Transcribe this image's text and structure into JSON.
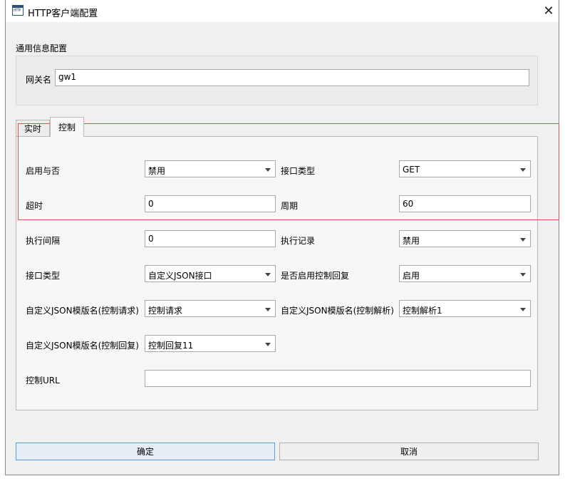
{
  "window": {
    "title": "HTTP客户端配置",
    "app_icon_text": "HTTP"
  },
  "general": {
    "section_label": "通用信息配置",
    "gateway_label": "网关名",
    "gateway_value": "gw1"
  },
  "tabs": [
    {
      "label": "实时",
      "active": false
    },
    {
      "label": "控制",
      "active": true
    }
  ],
  "control": {
    "enable_label": "启用与否",
    "enable_value": "禁用",
    "interface_type_label": "接口类型",
    "interface_type_value": "GET",
    "timeout_label": "超时",
    "timeout_value": "0",
    "period_label": "周期",
    "period_value": "60",
    "exec_interval_label": "执行间隔",
    "exec_interval_value": "0",
    "exec_record_label": "执行记录",
    "exec_record_value": "禁用",
    "ctrl_interface_type_label": "接口类型",
    "ctrl_interface_type_value": "自定义JSON接口",
    "ctrl_reply_enable_label": "是否启用控制回复",
    "ctrl_reply_enable_value": "启用",
    "tpl_request_label": "自定义JSON模版名(控制请求)",
    "tpl_request_value": "控制请求",
    "tpl_parse_label": "自定义JSON模版名(控制解析)",
    "tpl_parse_value": "控制解析1",
    "tpl_reply_label": "自定义JSON模版名(控制回复)",
    "tpl_reply_value": "控制回复11",
    "url_label": "控制URL",
    "url_value": ""
  },
  "buttons": {
    "ok": "确定",
    "cancel": "取消"
  },
  "colors": {
    "highlight_border": "#d9534f",
    "ok_border": "#5b9bd5"
  },
  "icons": {
    "close": "close-icon",
    "dropdown": "chevron-down-icon"
  }
}
